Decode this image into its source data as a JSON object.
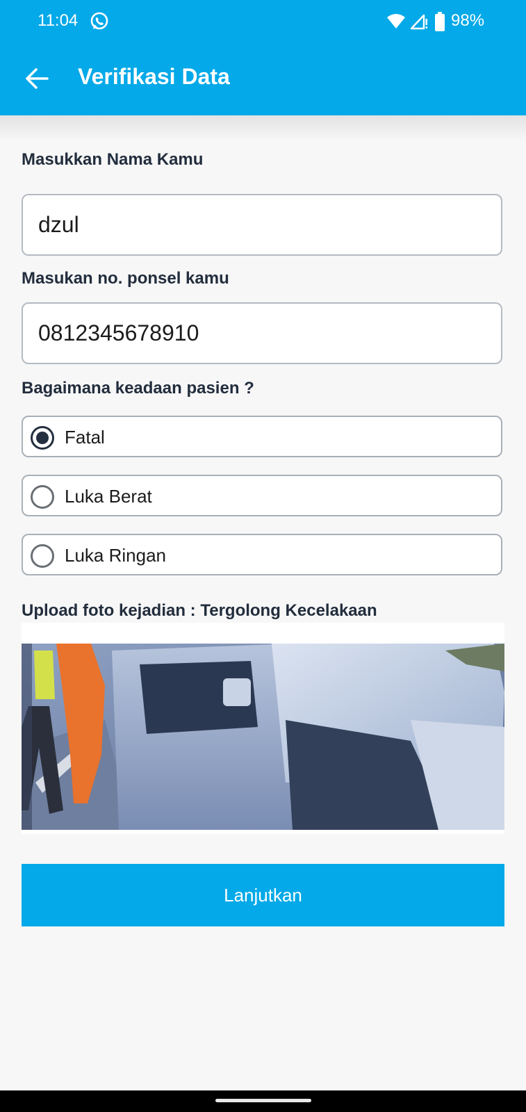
{
  "status_bar": {
    "time": "11:04",
    "battery": "98%",
    "icons": [
      "whatsapp-icon",
      "wifi-icon",
      "signal-icon",
      "battery-icon"
    ]
  },
  "app_bar": {
    "back_icon": "arrow-left-icon",
    "title": "Verifikasi Data"
  },
  "form": {
    "name_label": "Masukkan Nama Kamu",
    "name_value": "dzul",
    "phone_label": "Masukan no. ponsel kamu",
    "phone_value": "0812345678910",
    "condition_label": "Bagaimana keadaan pasien ?",
    "condition_options": [
      {
        "label": "Fatal",
        "selected": true
      },
      {
        "label": "Luka Berat",
        "selected": false
      },
      {
        "label": "Luka Ringan",
        "selected": false
      }
    ],
    "upload_label": "Upload foto kejadian : Tergolong Kecelakaan"
  },
  "submit_label": "Lanjutkan",
  "colors": {
    "primary": "#03a9e8",
    "background": "#f7f7f7",
    "text_dark": "#222d3d",
    "border": "#b4bac3"
  }
}
